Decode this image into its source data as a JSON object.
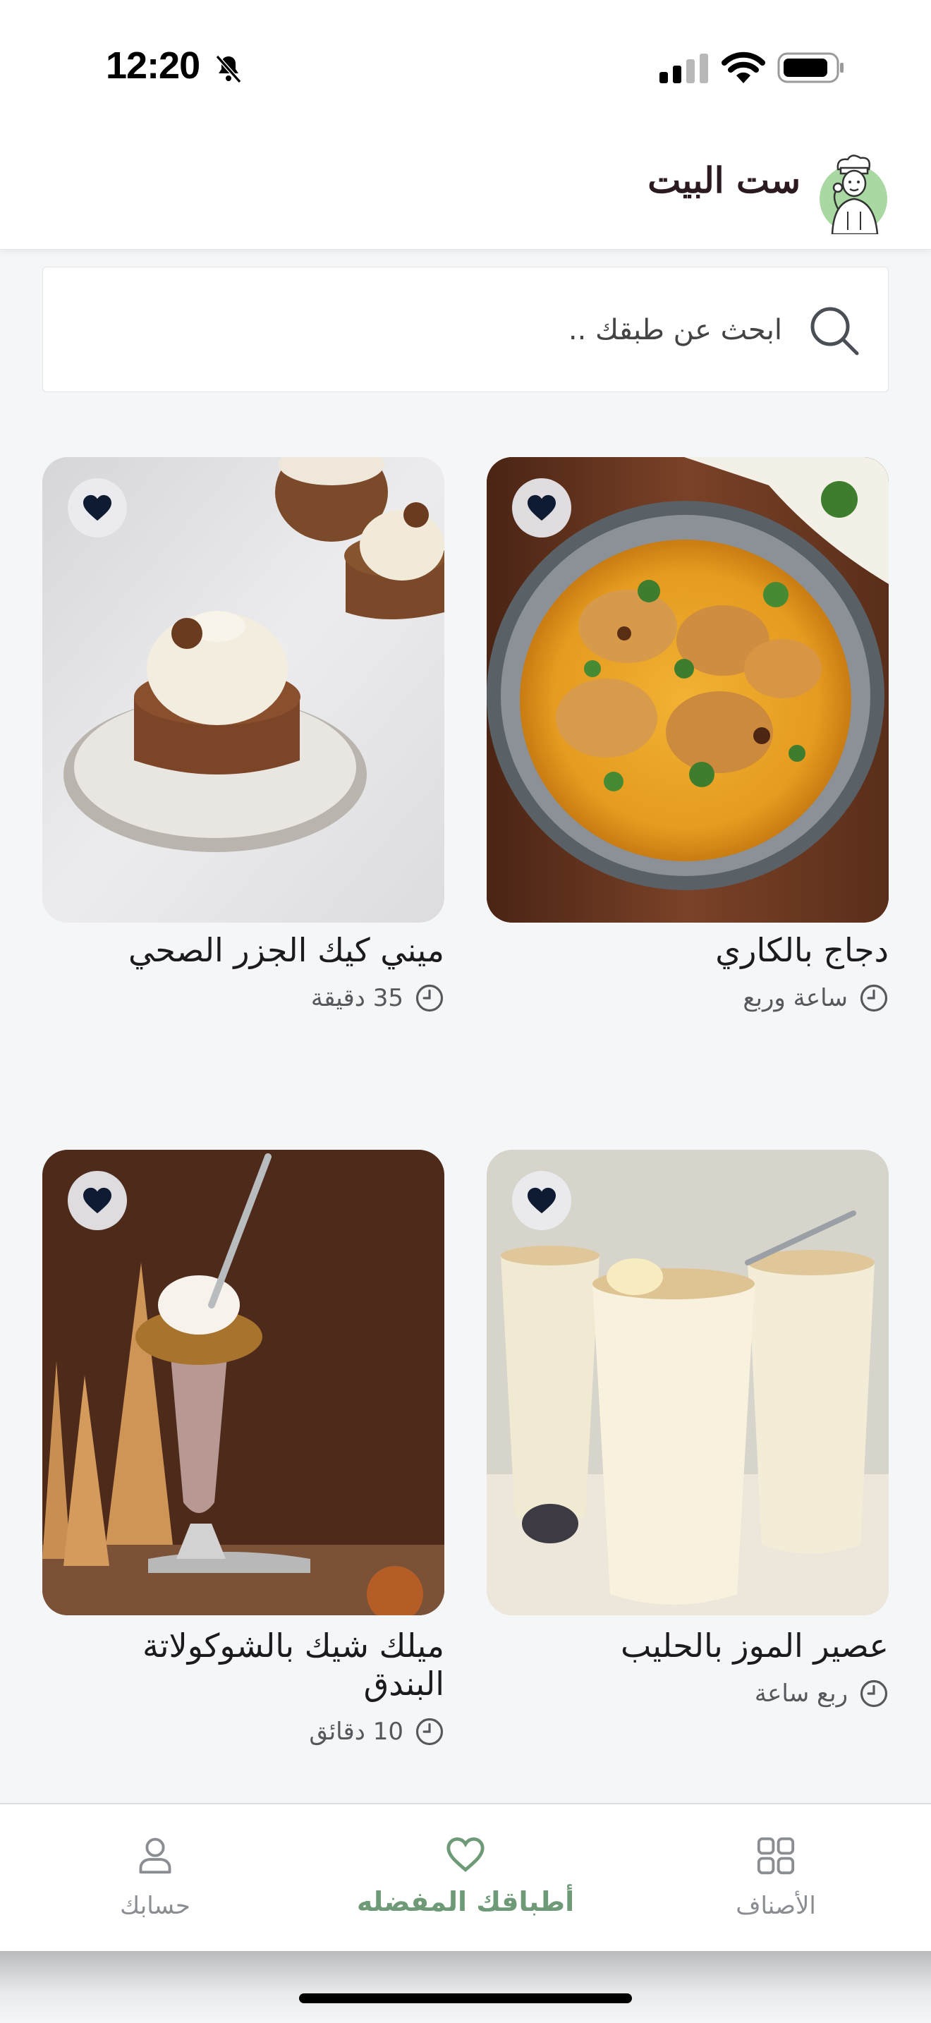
{
  "status_bar": {
    "time": "12:20"
  },
  "header": {
    "app_name": "ست البيت"
  },
  "search": {
    "placeholder": "ابحث عن طبقك .."
  },
  "recipes": [
    {
      "title": "دجاج  بالكاري",
      "duration": "ساعة وربع",
      "favorite": true
    },
    {
      "title": "ميني كيك الجزر الصحي",
      "duration": "35 دقيقة",
      "favorite": true
    },
    {
      "title": "عصير الموز بالحليب",
      "duration": "ربع ساعة",
      "favorite": true
    },
    {
      "title": "ميلك شيك بالشوكولاتة البندق",
      "duration": "10 دقائق",
      "favorite": true
    }
  ],
  "bottom_nav": {
    "categories": "الأصناف",
    "favorites": "أطباقك المفضله",
    "account": "حسابك",
    "active": "favorites"
  },
  "colors": {
    "accent": "#6f9a78",
    "heart": "#0f1b33"
  }
}
